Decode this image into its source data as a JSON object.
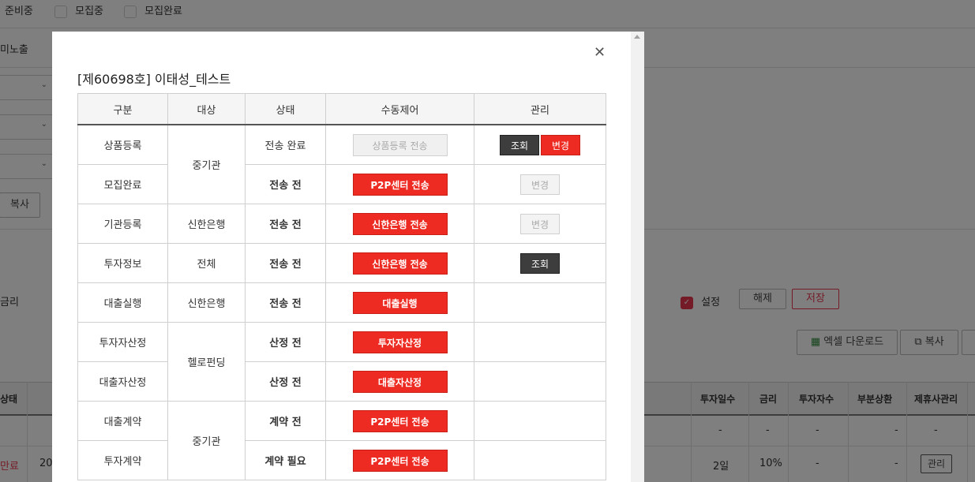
{
  "background": {
    "filter_status": [
      {
        "label": "준비중",
        "checked": false
      },
      {
        "label": "모집중",
        "checked": false
      },
      {
        "label": "모집완료",
        "checked": false
      }
    ],
    "exposure_label": "미노출",
    "copy_label": "복사",
    "rate_label": "금리",
    "setting_label": "설정",
    "release_label": "해제",
    "save_label": "저장",
    "excel_download_label": "엑셀 다운로드",
    "copy2_label": "복사",
    "table_headers": {
      "status": "상태",
      "invest_days": "투자일수",
      "rate": "금리",
      "investors": "투자자수",
      "partial": "부분상환",
      "partner": "제휴사관리"
    },
    "rows": [
      {
        "invest_days": "-",
        "rate": "-",
        "investors": "-",
        "partial": "-",
        "partner": "-"
      },
      {
        "status": "만료",
        "date": "202",
        "invest_days": "2일",
        "rate": "10%",
        "investors": "-",
        "partial": "-",
        "partner": "관리"
      }
    ]
  },
  "modal": {
    "title": "[제60698호] 이태성_테스트",
    "close_icon": "close-icon",
    "headers": [
      "구분",
      "대상",
      "상태",
      "수동제어",
      "관리"
    ],
    "rows": [
      {
        "category": "상품등록",
        "status": "전송 완료",
        "status_style": "plain",
        "control": "상품등록 전송",
        "control_style": "dis",
        "actions": [
          {
            "label": "조회",
            "style": "dark"
          },
          {
            "label": "변경",
            "style": "red"
          }
        ]
      },
      {
        "category": "모집완료",
        "status": "전송 전",
        "status_style": "red",
        "control": "P2P센터 전송",
        "control_style": "red",
        "actions": [
          {
            "label": "변경",
            "style": "dis"
          }
        ]
      },
      {
        "category": "기관등록",
        "target": "신한은행",
        "status": "전송 전",
        "status_style": "red",
        "control": "신한은행 전송",
        "control_style": "red",
        "actions": [
          {
            "label": "변경",
            "style": "dis"
          }
        ]
      },
      {
        "category": "투자정보",
        "target": "전체",
        "status": "전송 전",
        "status_style": "red",
        "control": "신한은행 전송",
        "control_style": "red",
        "actions": [
          {
            "label": "조회",
            "style": "dark"
          }
        ]
      },
      {
        "category": "대출실행",
        "target": "신한은행",
        "status": "전송 전",
        "status_style": "red",
        "control": "대출실행",
        "control_style": "red",
        "actions": []
      },
      {
        "category": "투자자산정",
        "status": "산정 전",
        "status_style": "red",
        "control": "투자자산정",
        "control_style": "red",
        "actions": []
      },
      {
        "category": "대출자산정",
        "status": "산정 전",
        "status_style": "red",
        "control": "대출자산정",
        "control_style": "red",
        "actions": []
      },
      {
        "category": "대출계약",
        "status": "계약 전",
        "status_style": "red",
        "control": "P2P센터 전송",
        "control_style": "red",
        "actions": []
      },
      {
        "category": "투자계약",
        "status": "계약 필요",
        "status_style": "red",
        "control": "P2P센터 전송",
        "control_style": "red",
        "actions": []
      }
    ],
    "merged_targets": [
      {
        "label": "중기관",
        "start": 0,
        "span": 2
      },
      {
        "label": "헬로펀딩",
        "start": 5,
        "span": 2
      },
      {
        "label": "중기관",
        "start": 7,
        "span": 2
      }
    ]
  }
}
